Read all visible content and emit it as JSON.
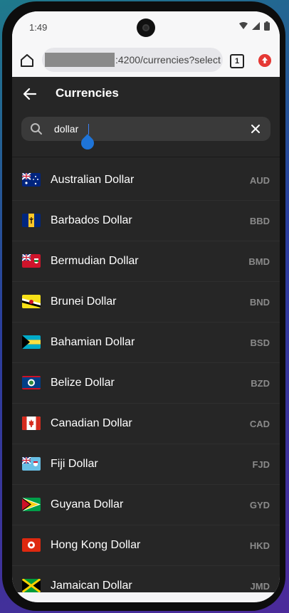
{
  "status_bar": {
    "time": "1:49"
  },
  "browser": {
    "url_suffix": ":4200/currencies?select",
    "tab_count": "1"
  },
  "app": {
    "title": "Currencies",
    "search": {
      "value": "dollar",
      "placeholder": ""
    }
  },
  "currencies": [
    {
      "name": "Australian Dollar",
      "code": "AUD",
      "flag": "australia-flag"
    },
    {
      "name": "Barbados Dollar",
      "code": "BBD",
      "flag": "barbados-flag"
    },
    {
      "name": "Bermudian Dollar",
      "code": "BMD",
      "flag": "bermuda-flag"
    },
    {
      "name": "Brunei Dollar",
      "code": "BND",
      "flag": "brunei-flag"
    },
    {
      "name": "Bahamian Dollar",
      "code": "BSD",
      "flag": "bahamas-flag"
    },
    {
      "name": "Belize Dollar",
      "code": "BZD",
      "flag": "belize-flag"
    },
    {
      "name": "Canadian Dollar",
      "code": "CAD",
      "flag": "canada-flag"
    },
    {
      "name": "Fiji Dollar",
      "code": "FJD",
      "flag": "fiji-flag"
    },
    {
      "name": "Guyana Dollar",
      "code": "GYD",
      "flag": "guyana-flag"
    },
    {
      "name": "Hong Kong Dollar",
      "code": "HKD",
      "flag": "hong-kong-flag"
    },
    {
      "name": "Jamaican Dollar",
      "code": "JMD",
      "flag": "jamaica-flag"
    }
  ],
  "colors": {
    "app_background": "#262626",
    "search_background": "#3a3a3a",
    "accent": "#1e74d8",
    "update_badge": "#e53935"
  }
}
